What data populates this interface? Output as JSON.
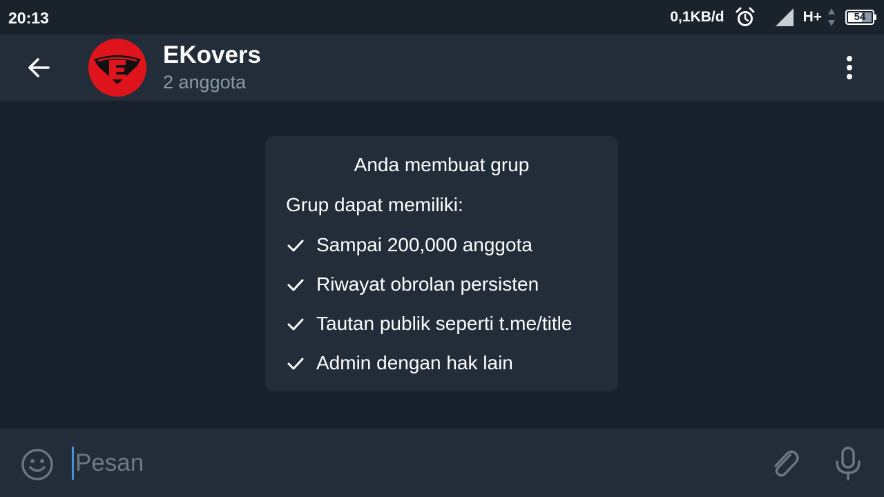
{
  "status_bar": {
    "time": "20:13",
    "net_speed": "0,1KB/d",
    "network_type": "H+",
    "battery_level": "54",
    "icons": [
      "alarm-icon",
      "signal-icon",
      "data-arrows-icon",
      "battery-icon"
    ]
  },
  "header": {
    "title": "EKovers",
    "subtitle": "2 anggota",
    "avatar_letter": "E",
    "avatar_color": "#e0141c",
    "icons": [
      "back-arrow-icon",
      "more-vert-icon"
    ]
  },
  "service_message": {
    "title": "Anda membuat grup",
    "intro": "Grup dapat memiliki:",
    "features": [
      "Sampai 200,000 anggota",
      "Riwayat obrolan persisten",
      "Tautan publik seperti t.me/title",
      "Admin dengan hak lain"
    ]
  },
  "composer": {
    "placeholder": "Pesan",
    "cursor_color": "#4f8ed6",
    "icons": [
      "emoji-icon",
      "attach-icon",
      "mic-icon"
    ]
  },
  "colors": {
    "background": "#18212b",
    "panel": "#222d39",
    "muted_text": "#8b99a6",
    "icon_gray": "#6c7883"
  }
}
